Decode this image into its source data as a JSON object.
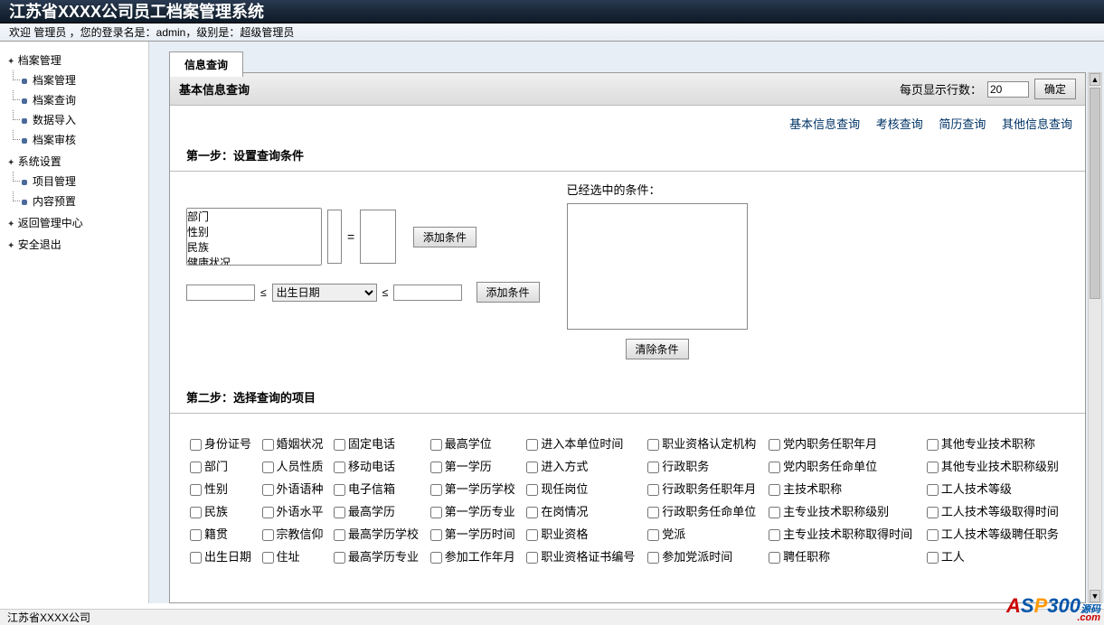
{
  "header": {
    "title": "江苏省XXXX公司员工档案管理系统"
  },
  "subheader": {
    "text": "欢迎 管理员 ，您的登录名是：admin，级别是：超级管理员"
  },
  "sidebar": {
    "nodes": [
      {
        "label": "档案管理",
        "children": [
          {
            "label": "档案管理"
          },
          {
            "label": "档案查询"
          },
          {
            "label": "数据导入"
          },
          {
            "label": "档案审核"
          }
        ]
      },
      {
        "label": "系统设置",
        "children": [
          {
            "label": "项目管理"
          },
          {
            "label": "内容预置"
          }
        ]
      },
      {
        "label": "返回管理中心"
      },
      {
        "label": "安全退出"
      }
    ]
  },
  "tab": {
    "label": "信息查询"
  },
  "sectionHeader": {
    "title": "基本信息查询",
    "rowsLabel": "每页显示行数：",
    "rowsValue": "20",
    "confirm": "确定"
  },
  "links": {
    "basic": "基本信息查询",
    "assess": "考核查询",
    "resume": "简历查询",
    "other": "其他信息查询"
  },
  "step1": {
    "title": "第一步：设置查询条件",
    "fieldOptions": [
      "部门",
      "性别",
      "民族",
      "健康状况"
    ],
    "eq": "=",
    "addCond": "添加条件",
    "lte": "≤",
    "dateField": "出生日期",
    "selectedLabel": "已经选中的条件：",
    "clear": "清除条件"
  },
  "step2": {
    "title": "第二步：选择查询的项目",
    "rows": [
      [
        "身份证号",
        "婚姻状况",
        "固定电话",
        "最高学位",
        "进入本单位时间",
        "职业资格认定机构",
        "党内职务任职年月",
        "其他专业技术职称"
      ],
      [
        "部门",
        "人员性质",
        "移动电话",
        "第一学历",
        "进入方式",
        "行政职务",
        "党内职务任命单位",
        "其他专业技术职称级别"
      ],
      [
        "性别",
        "外语语种",
        "电子信箱",
        "第一学历学校",
        "现任岗位",
        "行政职务任职年月",
        "主技术职称",
        "工人技术等级"
      ],
      [
        "民族",
        "外语水平",
        "最高学历",
        "第一学历专业",
        "在岗情况",
        "行政职务任命单位",
        "主专业技术职称级别",
        "工人技术等级取得时间"
      ],
      [
        "籍贯",
        "宗教信仰",
        "最高学历学校",
        "第一学历时间",
        "职业资格",
        "党派",
        "主专业技术职称取得时间",
        "工人技术等级聘任职务"
      ],
      [
        "出生日期",
        "住址",
        "最高学历专业",
        "参加工作年月",
        "职业资格证书编号",
        "参加党派时间",
        "聘任职称",
        "工人"
      ]
    ]
  },
  "footer": {
    "text": "江苏省XXXX公司"
  }
}
